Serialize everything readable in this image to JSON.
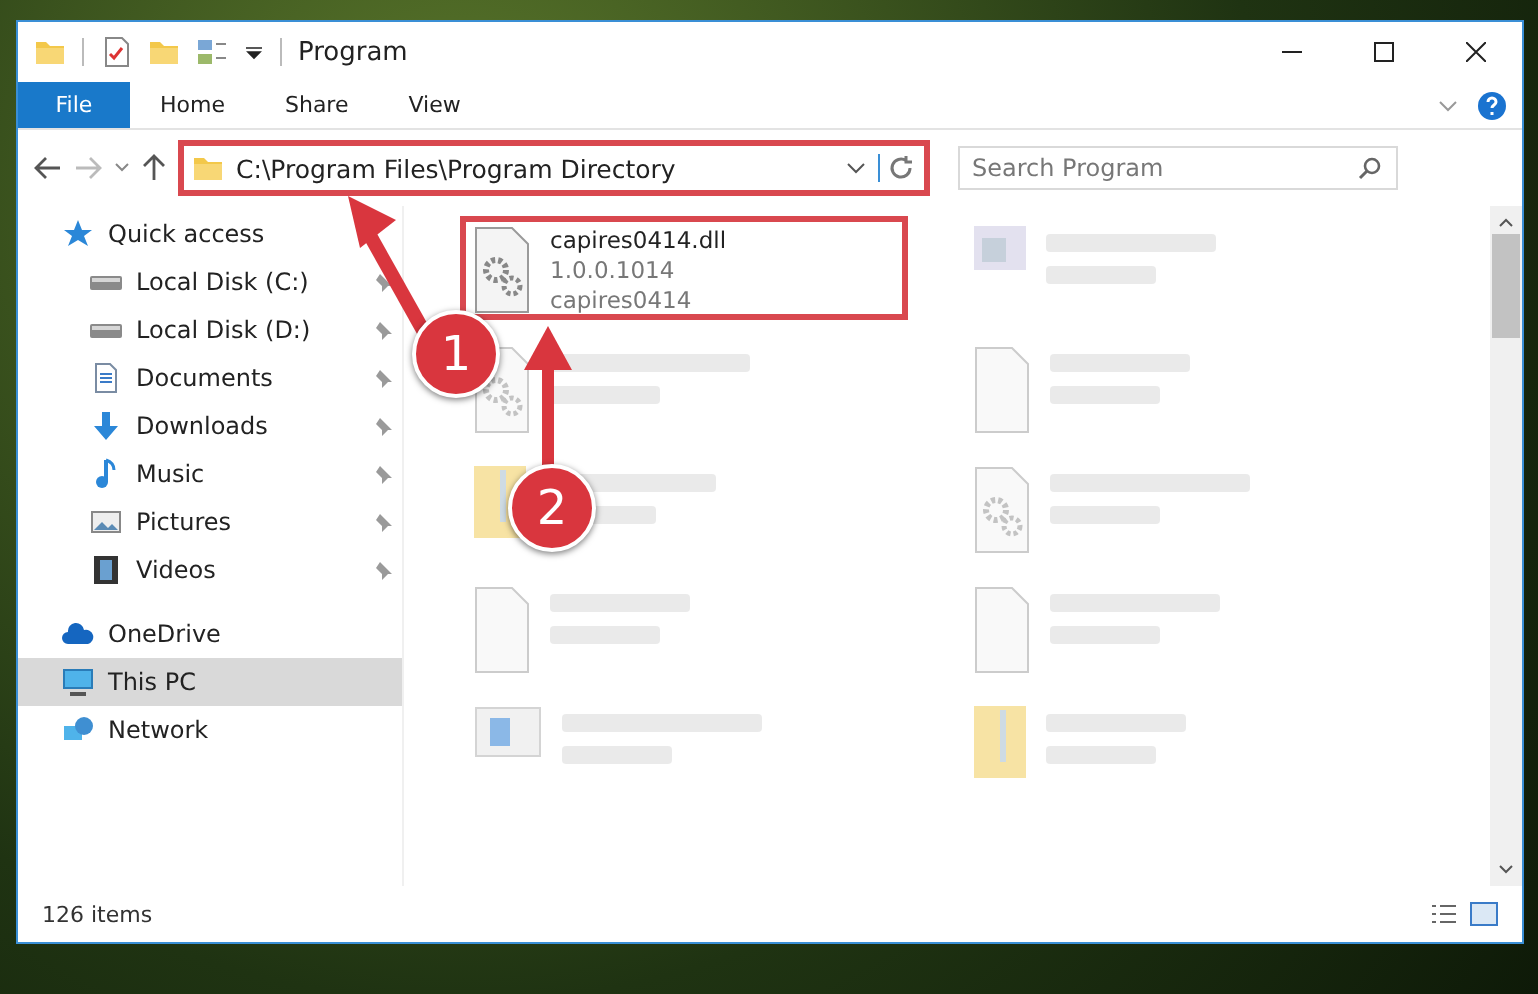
{
  "window": {
    "title": "Program"
  },
  "ribbon": {
    "tabs": [
      {
        "label": "File",
        "selected": true
      },
      {
        "label": "Home",
        "selected": false
      },
      {
        "label": "Share",
        "selected": false
      },
      {
        "label": "View",
        "selected": false
      }
    ]
  },
  "address_bar": {
    "path": "C:\\Program Files\\Program Directory",
    "highlighted": true
  },
  "search": {
    "placeholder": "Search Program"
  },
  "sidebar": {
    "items": [
      {
        "label": "Quick access",
        "kind": "star",
        "pinned": false,
        "selected": false,
        "children": [
          {
            "label": "Local Disk (C:)",
            "kind": "disk",
            "pinned": true,
            "selected": false
          },
          {
            "label": "Local Disk (D:)",
            "kind": "disk",
            "pinned": true,
            "selected": false
          },
          {
            "label": "Documents",
            "kind": "doc",
            "pinned": true,
            "selected": false
          },
          {
            "label": "Downloads",
            "kind": "download",
            "pinned": true,
            "selected": false
          },
          {
            "label": "Music",
            "kind": "music",
            "pinned": true,
            "selected": false
          },
          {
            "label": "Pictures",
            "kind": "picture",
            "pinned": true,
            "selected": false
          },
          {
            "label": "Videos",
            "kind": "video",
            "pinned": true,
            "selected": false
          }
        ]
      },
      {
        "label": "OneDrive",
        "kind": "cloud",
        "pinned": false,
        "selected": false
      },
      {
        "label": "This PC",
        "kind": "pc",
        "pinned": false,
        "selected": true
      },
      {
        "label": "Network",
        "kind": "network",
        "pinned": false,
        "selected": false
      }
    ]
  },
  "files": [
    {
      "name": "capires0414.dll",
      "lines": [
        "1.0.0.1014",
        "capires0414"
      ],
      "kind": "dll",
      "blurred": false,
      "highlighted": true
    },
    {
      "kind": "exe",
      "blurred": true,
      "highlighted": false
    },
    {
      "kind": "dll",
      "blurred": true,
      "highlighted": false
    },
    {
      "kind": "blank",
      "blurred": true,
      "highlighted": false
    },
    {
      "kind": "folder",
      "blurred": true,
      "highlighted": false
    },
    {
      "kind": "dll",
      "blurred": true,
      "highlighted": false
    },
    {
      "kind": "blank",
      "blurred": true,
      "highlighted": false
    },
    {
      "kind": "blank",
      "blurred": true,
      "highlighted": false
    },
    {
      "kind": "installer",
      "blurred": true,
      "highlighted": false
    },
    {
      "kind": "folder",
      "blurred": true,
      "highlighted": false
    }
  ],
  "annotations": [
    {
      "label": "1"
    },
    {
      "label": "2"
    }
  ],
  "status_bar": {
    "count": "126 items"
  }
}
